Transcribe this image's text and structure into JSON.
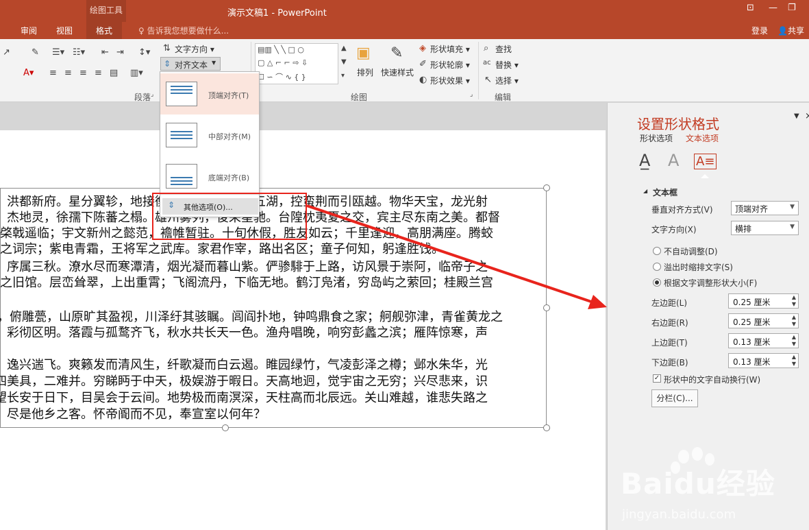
{
  "titlebar": {
    "context_tab": "绘图工具",
    "title": "演示文稿1 - PowerPoint"
  },
  "tabs": {
    "review": "审阅",
    "view": "视图",
    "format": "格式",
    "tell_me": "告诉我您想要做什么...",
    "login": "登录",
    "share": "共享"
  },
  "ribbon": {
    "text_direction": "文字方向",
    "align_text": "对齐文本",
    "paragraph_group": "段落",
    "arrange": "排列",
    "quick_styles": "快速样式",
    "shape_fill": "形状填充",
    "shape_outline": "形状轮廓",
    "shape_effects": "形状效果",
    "drawing_group": "绘图",
    "find": "查找",
    "replace": "替换",
    "select": "选择",
    "editing_group": "编辑"
  },
  "dropdown": {
    "items": [
      {
        "label": "顶端对齐(T)"
      },
      {
        "label": "中部对齐(M)"
      },
      {
        "label": "底端对齐(B)"
      }
    ],
    "more": "其他选项(O)..."
  },
  "slide_text": [
    "洪都新府。星分翼轸，地接衡庐。襟三江而带五湖，控蛮荆而引瓯越。物华天宝，龙光射",
    "杰地灵，徐孺下陈蕃之榻。雄州雾列，俊采星驰。台隍枕夷夏之交，宾主尽东南之美。都督",
    "棨戟遥临；宇文新州之懿范，襜帷暂驻。十旬休假，胜友如云；千里逢迎，高朋满座。腾蛟",
    "之词宗；紫电青霜，王将军之武库。家君作宰，路出名区；童子何知，躬逢胜饯。",
    "序属三秋。潦水尽而寒潭清，烟光凝而暮山紫。俨骖騑于上路，访风景于崇阿，临帝子之",
    "之旧馆。层峦耸翠，上出重霄；飞阁流丹，下临无地。鹤汀凫渚，穷岛屿之萦回；桂殿兰宫",
    "",
    "绣闼，俯雕甍，山原旷其盈视，川泽纡其骇瞩。闾阎扑地，钟鸣鼎食之家；舸舰弥津，青雀黄龙之",
    "彩彻区明。落霞与孤鹜齐飞，秋水共长天一色。渔舟唱晚，响穷彭蠡之滨；雁阵惊寒，声",
    "",
    "逸兴遄飞。爽籁发而清风生，纤歌凝而白云遏。睢园绿竹，气凌彭泽之樽；邺水朱华，光",
    "四美具，二难并。穷睇眄于中天，极娱游于暇日。天高地迥，觉宇宙之无穷；兴尽悲来，识",
    "望长安于日下，目吴会于云间。地势极而南溟深，天柱高而北辰远。关山难越，谁悲失路之",
    "尽是他乡之客。怀帝阍而不见，奉宣室以何年？"
  ],
  "pane": {
    "title": "设置形状格式",
    "tab_shape": "形状选项",
    "tab_text": "文本选项",
    "section": "文本框",
    "valign_label": "垂直对齐方式(V)",
    "valign_value": "顶端对齐",
    "direction_label": "文字方向(X)",
    "direction_value": "横排",
    "autofit_none": "不自动调整(D)",
    "autofit_shrink": "溢出时缩排文字(S)",
    "autofit_resize": "根据文字调整形状大小(F)",
    "left_label": "左边距(L)",
    "left_value": "0.25 厘米",
    "right_label": "右边距(R)",
    "right_value": "0.25 厘米",
    "top_label": "上边距(T)",
    "top_value": "0.13 厘米",
    "bottom_label": "下边距(B)",
    "bottom_value": "0.13 厘米",
    "wrap_label": "形状中的文字自动换行(W)",
    "columns_button": "分栏(C)..."
  },
  "watermark": {
    "brand": "Baidu经验",
    "url": "jingyan.baidu.com"
  },
  "colors": {
    "accent": "#b7472a",
    "highlight_red": "#e8241c",
    "pane_title": "#c23b22"
  }
}
